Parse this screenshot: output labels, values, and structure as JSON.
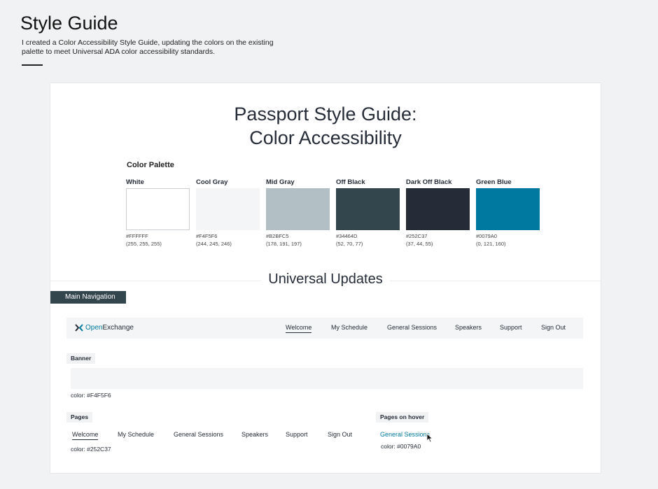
{
  "header": {
    "title": "Style Guide",
    "description": "I created a Color Accessibility Style Guide, updating the colors on the existing palette to meet Universal ADA color accessibility standards."
  },
  "card": {
    "heading_line1": "Passport Style Guide:",
    "heading_line2": "Color Accessibility",
    "palette_title": "Color Palette",
    "swatches": [
      {
        "name": "White",
        "hex": "#FFFFFF",
        "rgb": "(255, 255, 255)",
        "color": "#FFFFFF"
      },
      {
        "name": "Cool Gray",
        "hex": "#F4F5F6",
        "rgb": "(244, 245, 246)",
        "color": "#F4F5F6"
      },
      {
        "name": "Mid Gray",
        "hex": "#B2BFC5",
        "rgb": "(178, 191, 197)",
        "color": "#B2BFC5"
      },
      {
        "name": "Off Black",
        "hex": "#34464D",
        "rgb": "(52, 70, 77)",
        "color": "#34464D"
      },
      {
        "name": "Dark Off Black",
        "hex": "#252C37",
        "rgb": "(37, 44, 55)",
        "color": "#252C37"
      },
      {
        "name": "Green Blue",
        "hex": "#0079A0",
        "rgb": "(0, 121, 160)",
        "color": "#0079A0"
      }
    ],
    "section_title": "Universal Updates",
    "main_nav_label": "Main Navigation",
    "logo_open": "Open",
    "logo_exchange": "Exchange",
    "nav_items": [
      "Welcome",
      "My Schedule",
      "General Sessions",
      "Speakers",
      "Support",
      "Sign Out"
    ],
    "banner_label": "Banner",
    "banner_note": "color: #F4F5F6",
    "pages_label": "Pages",
    "pages_items": [
      "Welcome",
      "My Schedule",
      "General Sessions",
      "Speakers",
      "Support",
      "Sign Out"
    ],
    "pages_note": "color: #252C37",
    "hover_label": "Pages on hover",
    "hover_link": "General Sessions",
    "hover_note": "color: #0079A0"
  }
}
